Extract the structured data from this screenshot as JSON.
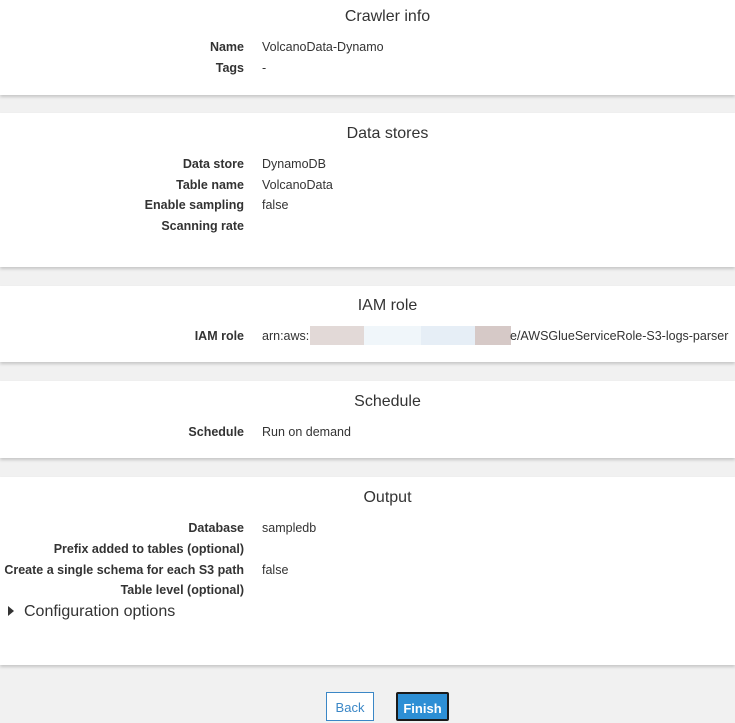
{
  "crawler_info": {
    "title": "Crawler info",
    "rows": [
      {
        "label": "Name",
        "value": "VolcanoData-Dynamo"
      },
      {
        "label": "Tags",
        "value": "-"
      }
    ]
  },
  "data_stores": {
    "title": "Data stores",
    "rows": [
      {
        "label": "Data store",
        "value": "DynamoDB"
      },
      {
        "label": "Table name",
        "value": "VolcanoData"
      },
      {
        "label": "Enable sampling",
        "value": "false"
      },
      {
        "label": "Scanning rate",
        "value": ""
      }
    ]
  },
  "iam_role": {
    "title": "IAM role",
    "label": "IAM role",
    "value_prefix": "arn:aws:",
    "value_suffix": "e/AWSGlueServiceRole-S3-logs-parser",
    "redaction_colors": [
      "#e2d9d7",
      "#f0f6fa",
      "#e6eef6",
      "#d6c9c7"
    ]
  },
  "schedule": {
    "title": "Schedule",
    "rows": [
      {
        "label": "Schedule",
        "value": "Run on demand"
      }
    ]
  },
  "output": {
    "title": "Output",
    "rows": [
      {
        "label": "Database",
        "value": "sampledb"
      },
      {
        "label": "Prefix added to tables (optional)",
        "value": ""
      },
      {
        "label": "Create a single schema for each S3 path",
        "value": "false"
      },
      {
        "label": "Table level (optional)",
        "value": ""
      }
    ],
    "config_toggle": "Configuration options"
  },
  "buttons": {
    "back": "Back",
    "finish": "Finish"
  },
  "colors": {
    "primary": "#2d8fd5",
    "page_bg": "#f1f1f1"
  }
}
